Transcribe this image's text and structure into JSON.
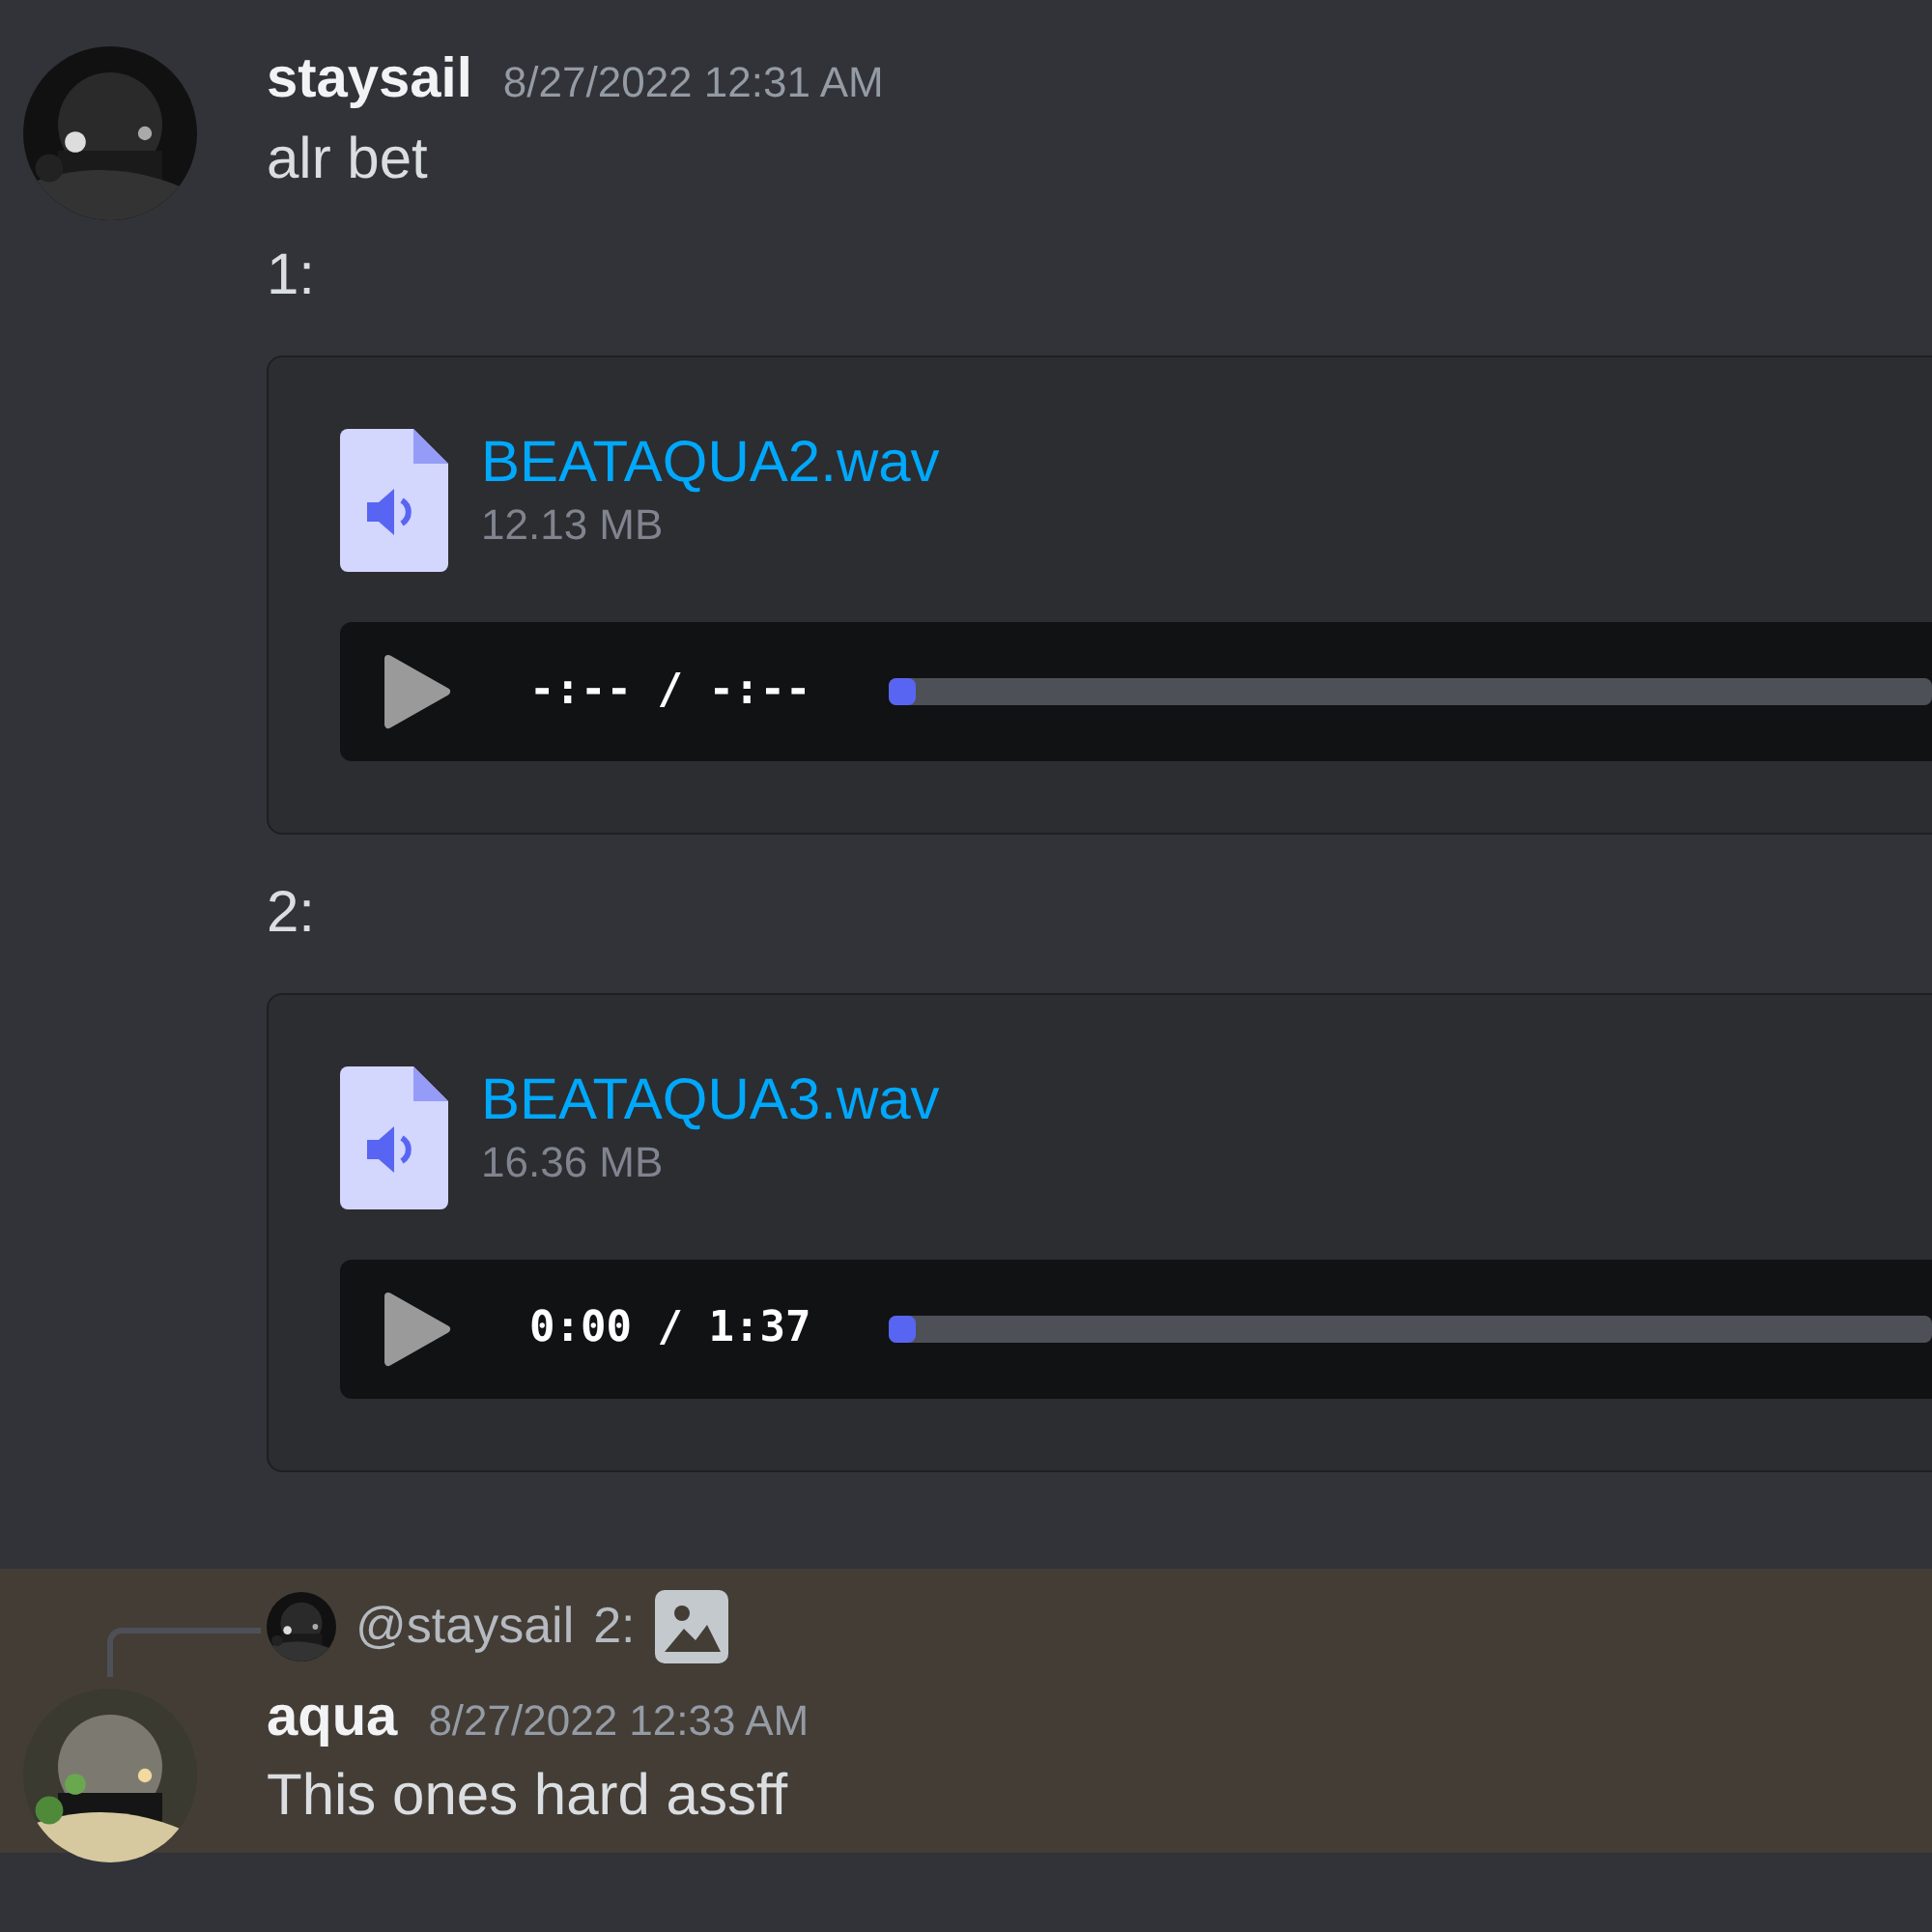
{
  "messages": [
    {
      "author": "staysail",
      "timestamp": "8/27/2022 12:31 AM",
      "highlighted": false,
      "lines": [
        {
          "kind": "text",
          "text": "alr bet"
        },
        {
          "kind": "text",
          "text": "1:"
        },
        {
          "kind": "audio",
          "filename": "BEATAQUA2.wav",
          "size": "12.13 MB",
          "time": "-:-- / -:--",
          "level": 0
        },
        {
          "kind": "text",
          "text": "2:"
        },
        {
          "kind": "audio",
          "filename": "BEATAQUA3.wav",
          "size": "16.36 MB",
          "time": "0:00 / 1:37",
          "level": 0
        }
      ]
    },
    {
      "author": "aqua",
      "timestamp": "8/27/2022 12:33 AM",
      "highlighted": true,
      "reply": {
        "author": "@staysail",
        "text": "2:",
        "has_image": true
      },
      "lines": [
        {
          "kind": "text",
          "text": "This ones hard assff"
        }
      ]
    }
  ]
}
